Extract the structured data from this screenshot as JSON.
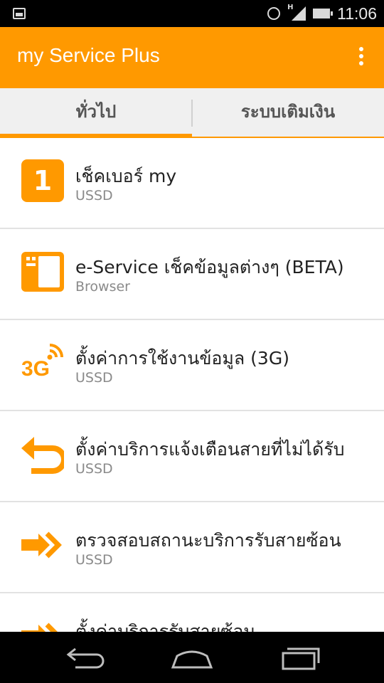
{
  "status_bar": {
    "time": "11:06",
    "signal_label": "H",
    "icons": [
      "image-icon",
      "alarm-icon",
      "signal-icon",
      "battery-icon"
    ]
  },
  "app_bar": {
    "title": "my Service Plus",
    "menu_icon": "overflow-menu-icon"
  },
  "tabs": [
    {
      "label": "ทั่วไป",
      "selected": true
    },
    {
      "label": "ระบบเติมเงิน",
      "selected": false
    }
  ],
  "items": [
    {
      "title": "เช็คเบอร์ my",
      "subtitle": "USSD",
      "icon": "number-one-icon",
      "icon_text": "1"
    },
    {
      "title": "e-Service เช็คข้อมูลต่างๆ (BETA)",
      "subtitle": "Browser",
      "icon": "sim-card-icon"
    },
    {
      "title": "ตั้งค่าการใช้งานข้อมูล (3G)",
      "subtitle": "USSD",
      "icon": "3g-signal-icon",
      "icon_text": "3G"
    },
    {
      "title": "ตั้งค่าบริการแจ้งเตือนสายที่ไม่ได้รับ",
      "subtitle": "USSD",
      "icon": "return-arrow-icon"
    },
    {
      "title": "ตรวจสอบสถานะบริการรับสายซ้อน",
      "subtitle": "USSD",
      "icon": "forward-arrows-icon"
    },
    {
      "title": "ตั้งค่าบริการรับสายซ้อน",
      "subtitle": "",
      "icon": "forward-arrows-icon"
    }
  ],
  "nav_bar": {
    "buttons": [
      "back-icon",
      "home-icon",
      "recents-icon"
    ]
  },
  "colors": {
    "accent": "#ff9900",
    "status_bar": "#000000",
    "tab_bg": "#f0f0f0",
    "title_text": "#222222",
    "subtitle_text": "#8a8a8a"
  }
}
